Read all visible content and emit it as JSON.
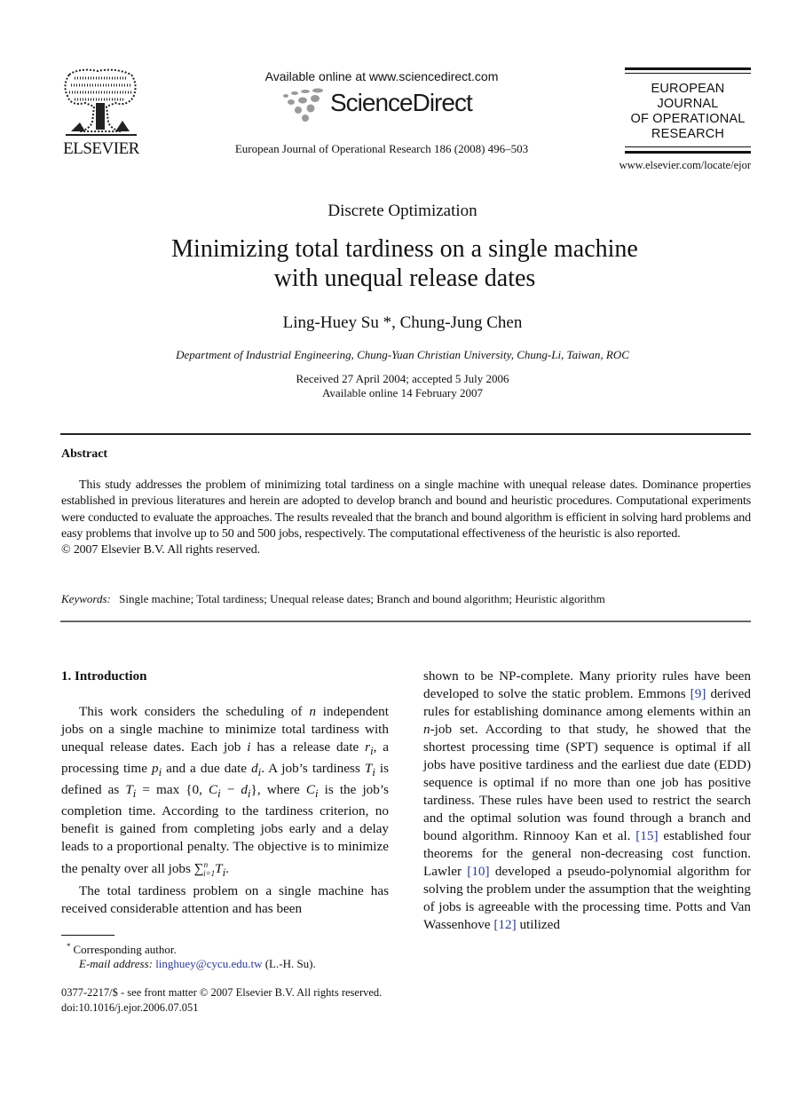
{
  "header": {
    "publisher_logo_text": "ELSEVIER",
    "available_online": "Available online at www.sciencedirect.com",
    "sciencedirect_logo": "ScienceDirect",
    "journal_citation": "European Journal of Operational Research 186 (2008) 496–503",
    "journal_logo_lines": [
      "EUROPEAN",
      "JOURNAL",
      "OF OPERATIONAL",
      "RESEARCH"
    ],
    "journal_url": "www.elsevier.com/locate/ejor"
  },
  "article": {
    "section": "Discrete Optimization",
    "title_line1": "Minimizing total tardiness on a single machine",
    "title_line2": "with unequal release dates",
    "authors": "Ling-Huey Su *, Chung-Jung Chen",
    "affiliation": "Department of Industrial Engineering, Chung-Yuan Christian University, Chung-Li, Taiwan, ROC",
    "received": "Received 27 April 2004; accepted 5 July 2006",
    "available": "Available online 14 February 2007"
  },
  "abstract": {
    "heading": "Abstract",
    "body": "This study addresses the problem of minimizing total tardiness on a single machine with unequal release dates. Dominance properties established in previous literatures and herein are adopted to develop branch and bound and heuristic procedures. Computational experiments were conducted to evaluate the approaches. The results revealed that the branch and bound algorithm is efficient in solving hard problems and easy problems that involve up to 50 and 500 jobs, respectively. The computational effectiveness of the heuristic is also reported.",
    "copyright": "© 2007 Elsevier B.V. All rights reserved.",
    "keywords_label": "Keywords:",
    "keywords": "Single machine; Total tardiness; Unequal release dates; Branch and bound algorithm; Heuristic algorithm"
  },
  "introduction": {
    "heading": "1. Introduction",
    "p1": {
      "a": "This work considers the scheduling of ",
      "n": "n",
      "b": " independent jobs on a single machine to minimize total tardiness with unequal release dates. Each job ",
      "i": "i",
      "c": " has a release date ",
      "ri": "r",
      "d": ", a processing time ",
      "pi": "p",
      "e": " and a due date ",
      "di": "d",
      "f": ". A job’s tardiness ",
      "Ti": "T",
      "g": " is defined as ",
      "formula": "T",
      "h": " = max {0, ",
      "Ci": "C",
      "minus": " − ",
      "di2": "d",
      "j": "}, where ",
      "Ci2": "C",
      "k": " is the job’s completion time. According to the tardiness criterion, no benefit is gained from completing jobs early and a delay leads to a proportional penalty. The objective is to minimize the penalty over all jobs ",
      "sum": "∑",
      "sum_sup": "n",
      "sum_sub": "i=1",
      "sum_T": "T",
      "end": "."
    },
    "p2_left": "The total tardiness problem on a single machine has received considerable attention and has been",
    "right": {
      "a": "shown to be NP-complete. Many priority rules have been developed to solve the static problem. Emmons ",
      "ref9": "[9]",
      "b": " derived rules for establishing dominance among elements within an ",
      "n": "n",
      "c": "-job set. According to that study, he showed that the shortest processing time (SPT) sequence is optimal if all jobs have positive tardiness and the earliest due date (EDD) sequence is optimal if no more than one job has positive tardiness. These rules have been used to restrict the search and the optimal solution was found through a branch and bound algorithm. Rinnooy Kan et al. ",
      "ref15": "[15]",
      "d": " established four theorems for the general non-decreasing cost function. Lawler ",
      "ref10": "[10]",
      "e": " developed a pseudo-polynomial algorithm for solving the problem under the assumption that the weighting of jobs is agreeable with the processing time. Potts and Van Wassenhove ",
      "ref12": "[12]",
      "f": " utilized"
    },
    "subscript_i": "i"
  },
  "footnote": {
    "marker": "*",
    "corresponding": "Corresponding author.",
    "email_label": "E-mail address:",
    "email": "linghuey@cycu.edu.tw",
    "email_suffix": "(L.-H. Su)."
  },
  "footer": {
    "issn_line": "0377-2217/$ - see front matter © 2007 Elsevier B.V. All rights reserved.",
    "doi": "doi:10.1016/j.ejor.2006.07.051"
  },
  "colors": {
    "link": "#2b3a8f",
    "text": "#111111",
    "logo_gray": "#9a9a9a"
  }
}
